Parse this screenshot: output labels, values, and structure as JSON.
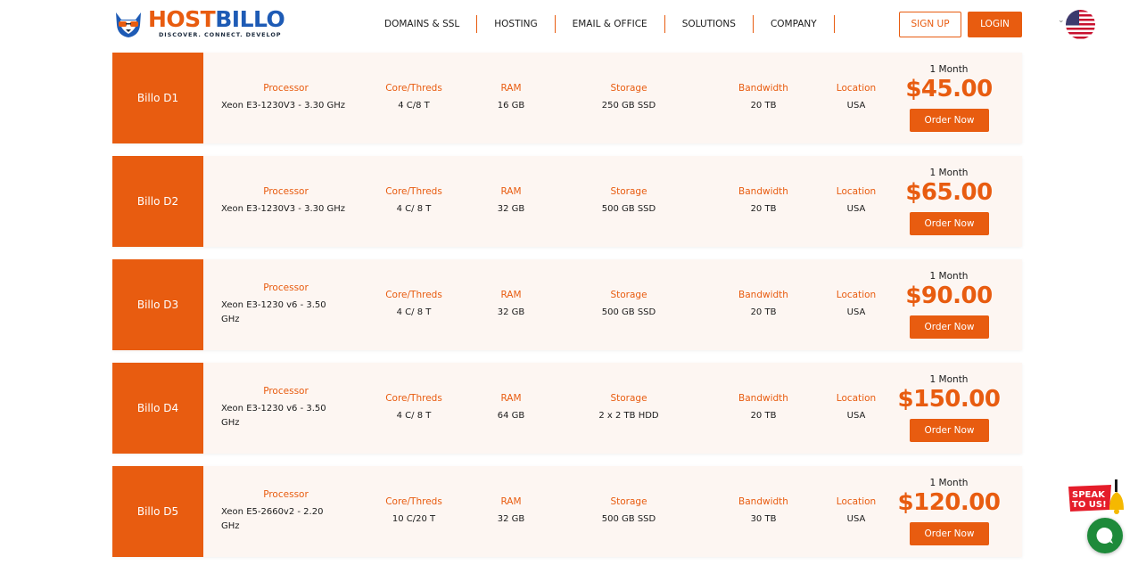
{
  "brand": {
    "name_part1": "HOST",
    "name_part2": "BILLO",
    "tagline": "DISCOVER. CONNECT. DEVELOP",
    "accent_color": "#e85c10",
    "secondary_color": "#1e5bb5"
  },
  "nav": {
    "items": [
      "DOMAINS & SSL",
      "HOSTING",
      "EMAIL & OFFICE",
      "SOLUTIONS",
      "COMPANY"
    ],
    "signup_label": "SIGN UP",
    "login_label": "LOGIN",
    "language_icon": "us-flag-icon"
  },
  "labels": {
    "processor": "Processor",
    "cores": "Core/Threds",
    "ram": "RAM",
    "storage": "Storage",
    "bandwidth": "Bandwidth",
    "location": "Location",
    "order": "Order Now"
  },
  "plans": [
    {
      "name": "Billo D1",
      "processor": "Xeon E3-1230V3 - 3.30 GHz",
      "cores": "4 C/8 T",
      "ram": "16 GB",
      "storage": "250 GB SSD",
      "bandwidth": "20 TB",
      "location": "USA",
      "term": "1 Month",
      "price": "$45.00"
    },
    {
      "name": "Billo D2",
      "processor": "Xeon E3-1230V3 - 3.30 GHz",
      "cores": "4 C/ 8 T",
      "ram": "32 GB",
      "storage": "500 GB SSD",
      "bandwidth": "20 TB",
      "location": "USA",
      "term": "1 Month",
      "price": "$65.00"
    },
    {
      "name": "Billo D3",
      "processor": "Xeon E3-1230 v6 - 3.50 GHz",
      "cores": "4 C/ 8 T",
      "ram": "32 GB",
      "storage": "500 GB SSD",
      "bandwidth": "20 TB",
      "location": "USA",
      "term": "1 Month",
      "price": "$90.00"
    },
    {
      "name": "Billo D4",
      "processor": "Xeon E3-1230 v6 - 3.50 GHz",
      "cores": "4 C/ 8 T",
      "ram": "64 GB",
      "storage": "2 x 2 TB HDD",
      "bandwidth": "20 TB",
      "location": "USA",
      "term": "1 Month",
      "price": "$150.00"
    },
    {
      "name": "Billo D5",
      "processor": "Xeon E5-2660v2 - 2.20 GHz",
      "cores": "10 C/20 T",
      "ram": "32 GB",
      "storage": "500 GB SSD",
      "bandwidth": "30 TB",
      "location": "USA",
      "term": "1 Month",
      "price": "$120.00"
    }
  ],
  "widgets": {
    "speak_text_line1": "SPEAK",
    "speak_text_line2": "TO US!",
    "speak_icon": "bell-icon",
    "chat_icon": "chat-bubble-icon"
  }
}
